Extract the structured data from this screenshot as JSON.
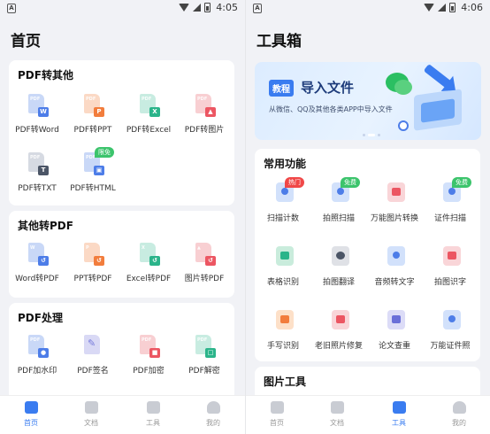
{
  "left": {
    "status": {
      "badge": "A",
      "time": "4:05"
    },
    "title": "首页",
    "sections": [
      {
        "title": "PDF转其他",
        "items": [
          {
            "label": "PDF转Word",
            "tag": "PDF",
            "mini": "W"
          },
          {
            "label": "PDF转PPT",
            "tag": "PDF",
            "mini": "P"
          },
          {
            "label": "PDF转Excel",
            "tag": "PDF",
            "mini": "X"
          },
          {
            "label": "PDF转图片",
            "tag": "PDF",
            "mini": "▲"
          },
          {
            "label": "PDF转TXT",
            "tag": "PDF",
            "mini": "T"
          },
          {
            "label": "PDF转HTML",
            "tag": "PDF",
            "mini": "▣",
            "badge": "限免"
          }
        ]
      },
      {
        "title": "其他转PDF",
        "items": [
          {
            "label": "Word转PDF",
            "tag": "W",
            "mini": "↺"
          },
          {
            "label": "PPT转PDF",
            "tag": "P",
            "mini": "↺"
          },
          {
            "label": "Excel转PDF",
            "tag": "X",
            "mini": "↺"
          },
          {
            "label": "图片转PDF",
            "tag": "▲",
            "mini": "↺"
          }
        ]
      },
      {
        "title": "PDF处理",
        "items": [
          {
            "label": "PDF加水印",
            "tag": "PDF",
            "mini": "●"
          },
          {
            "label": "PDF签名",
            "tag": "✎",
            "mini": ""
          },
          {
            "label": "PDF加密",
            "tag": "PDF",
            "mini": "■"
          },
          {
            "label": "PDF解密",
            "tag": "PDF",
            "mini": "□"
          }
        ]
      }
    ],
    "tabs": [
      {
        "label": "首页",
        "icon": "home-icon",
        "active": true
      },
      {
        "label": "文档",
        "icon": "folder-icon",
        "active": false
      },
      {
        "label": "工具",
        "icon": "toolbox-icon",
        "active": false
      },
      {
        "label": "我的",
        "icon": "user-icon",
        "active": false
      }
    ]
  },
  "right": {
    "status": {
      "badge": "A",
      "time": "4:06"
    },
    "title": "工具箱",
    "banner": {
      "chip": "教程",
      "headline": "导入文件",
      "subtitle": "从微信、QQ及其他各类APP中导入文件"
    },
    "common": {
      "title": "常用功能",
      "items": [
        {
          "label": "扫描计数",
          "icon": "scan-count-icon",
          "badge": "热门"
        },
        {
          "label": "拍照扫描",
          "icon": "photo-scan-icon",
          "badge": "免费"
        },
        {
          "label": "万能图片转换",
          "icon": "image-convert-icon"
        },
        {
          "label": "证件扫描",
          "icon": "id-scan-icon",
          "badge": "免费"
        },
        {
          "label": "表格识别",
          "icon": "table-recognize-icon"
        },
        {
          "label": "拍图翻译",
          "icon": "camera-translate-icon"
        },
        {
          "label": "音频转文字",
          "icon": "audio-to-text-icon"
        },
        {
          "label": "拍图识字",
          "icon": "photo-ocr-icon"
        },
        {
          "label": "手写识别",
          "icon": "handwriting-icon"
        },
        {
          "label": "老旧照片修复",
          "icon": "photo-repair-icon"
        },
        {
          "label": "论文查重",
          "icon": "thesis-check-icon"
        },
        {
          "label": "万能证件照",
          "icon": "id-photo-icon"
        }
      ]
    },
    "image_tools": {
      "title": "图片工具"
    },
    "tabs": [
      {
        "label": "首页",
        "icon": "home-icon",
        "active": false
      },
      {
        "label": "文档",
        "icon": "folder-icon",
        "active": false
      },
      {
        "label": "工具",
        "icon": "toolbox-icon",
        "active": true
      },
      {
        "label": "我的",
        "icon": "user-icon",
        "active": false
      }
    ]
  },
  "colors": {
    "accent": "#3a7cf0",
    "badge_green": "#3cc46c",
    "badge_red": "#f04848"
  }
}
